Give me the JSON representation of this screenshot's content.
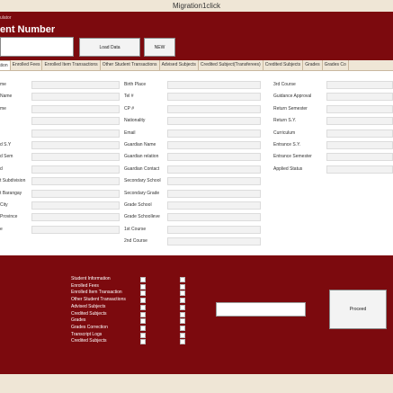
{
  "window": {
    "title": "Migration1click"
  },
  "header": {
    "subtitle": "ulator",
    "title": "ent Number",
    "student_number": "",
    "load_label": "Load Data",
    "new_label": "NEW"
  },
  "tabs": [
    "nformation",
    "Enrolled Fees",
    "Enrolled Item Transactions",
    "Other Student Transactions",
    "Advised Subjects",
    "Credited Subject(Transferees)",
    "Credited Subjects",
    "Grades",
    "Grades Co"
  ],
  "form": {
    "col1": [
      "me",
      "Name",
      "me",
      "",
      "",
      "d S.Y",
      "d Sem",
      "d",
      "t Subdivision",
      "t Barangay",
      "City",
      "Province",
      "e"
    ],
    "col2": [
      "Birth Place",
      "Tel #",
      "CP #",
      "Nationality",
      "Email",
      "Guardian Name",
      "Guardian relation",
      "Guardian Contact",
      "Secondary School",
      "Secondary Grade",
      "Grade School",
      "Grade Schoolleve",
      "1st Course",
      "2nd Course"
    ],
    "col3": [
      "3rd Course",
      "Guidance Approval",
      "Return Semester",
      "Return S.Y.",
      "Curriculum",
      "Entrance S.Y.",
      "Entrance Semester",
      "Applied Status"
    ]
  },
  "migration": {
    "items": [
      "Student Information",
      "Enrolled Fees",
      "Enrolled Item Transaction",
      "Other Student Transactions",
      "Advised Subjects",
      "Credited Subjects",
      "Grades",
      "Grades Correction",
      "Transcript Logs",
      "Credited Subjects"
    ],
    "col_header_1": "",
    "col_header_2": "",
    "target_label": "",
    "target_value": "",
    "proceed_label": "Proceed"
  }
}
